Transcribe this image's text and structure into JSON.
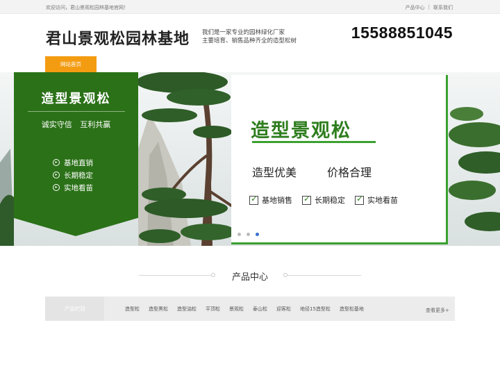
{
  "topbar": {
    "welcome": "欢迎访问，君山景观松园林基地官网！",
    "links": [
      "产品中心",
      "联系我们"
    ],
    "separator": "|"
  },
  "header": {
    "brand": "君山景观松园林基地",
    "intro_line1": "我们是一家专业的园林绿化厂家",
    "intro_line2": "主要培育、销售品种齐全的造型松树",
    "phone": "15588851045"
  },
  "nav": {
    "home": "网站首页"
  },
  "banner": {
    "panel_title": "造型景观松",
    "panel_slogan": "诚实守信 互利共赢",
    "panel_items": [
      "基地直销",
      "长期稳定",
      "实地看苗"
    ],
    "card_title": "造型景观松",
    "card_sub1": "造型优美",
    "card_sub2": "价格合理",
    "card_checks": [
      "基地销售",
      "长期稳定",
      "实地看苗"
    ],
    "slide_count": 3,
    "active_slide": 3,
    "colors": {
      "panel_green": "#2b7118",
      "accent_green": "#3aa02d",
      "active_dot": "#3b6fd1"
    }
  },
  "products": {
    "section_title": "产品中心",
    "category_label": "产品栏目",
    "categories": [
      "造型松",
      "造型黑松",
      "造型油松",
      "平顶松",
      "景观松",
      "泰山松",
      "迎客松",
      "地径15造型松",
      "造型松基地"
    ],
    "more": "查看更多+"
  },
  "colors": {
    "nav_orange": "#f39c12"
  }
}
